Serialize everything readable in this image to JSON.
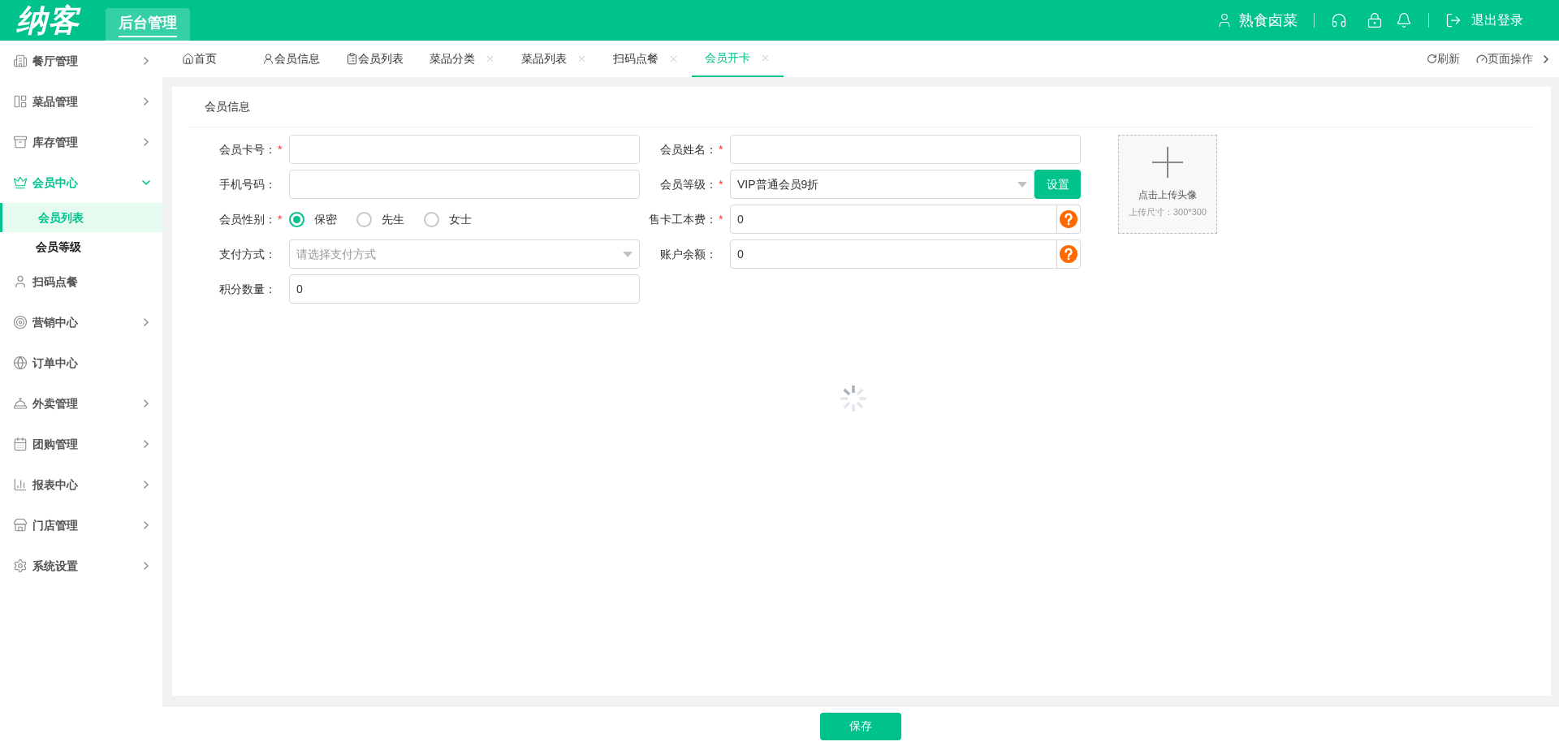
{
  "header": {
    "logo": "纳客",
    "module_tab": "后台管理",
    "user": "熟食卤菜",
    "logout": "退出登录"
  },
  "sidebar": {
    "items": [
      {
        "label": "餐厅管理",
        "kind": "group",
        "expanded": false
      },
      {
        "label": "菜品管理",
        "kind": "group",
        "expanded": false
      },
      {
        "label": "库存管理",
        "kind": "group",
        "expanded": false
      },
      {
        "label": "会员中心",
        "kind": "group",
        "expanded": true,
        "children": [
          {
            "label": "会员列表",
            "selected": true
          },
          {
            "label": "会员等级",
            "selected": false
          }
        ]
      },
      {
        "label": "扫码点餐",
        "kind": "link",
        "expanded": false
      },
      {
        "label": "营销中心",
        "kind": "group",
        "expanded": false
      },
      {
        "label": "订单中心",
        "kind": "link",
        "expanded": false
      },
      {
        "label": "外卖管理",
        "kind": "group",
        "expanded": false
      },
      {
        "label": "团购管理",
        "kind": "group",
        "expanded": false
      },
      {
        "label": "报表中心",
        "kind": "group",
        "expanded": false
      },
      {
        "label": "门店管理",
        "kind": "group",
        "expanded": false
      },
      {
        "label": "系统设置",
        "kind": "group",
        "expanded": false
      }
    ]
  },
  "tabs": [
    {
      "label": "首页",
      "selected": false,
      "closable": false
    },
    {
      "label": "会员信息",
      "selected": false,
      "closable": false
    },
    {
      "label": "会员列表",
      "selected": false,
      "closable": false
    },
    {
      "label": "菜品分类",
      "selected": false,
      "closable": true
    },
    {
      "label": "菜品列表",
      "selected": false,
      "closable": true
    },
    {
      "label": "扫码点餐",
      "selected": false,
      "closable": true
    },
    {
      "label": "会员开卡",
      "selected": true,
      "closable": true
    }
  ],
  "tab_actions": {
    "refresh": "刷新",
    "page_ops": "页面操作"
  },
  "form": {
    "title": "会员信息",
    "required_mark": "*",
    "left": [
      {
        "kind": "text",
        "label": "会员卡号：",
        "required": true
      },
      {
        "kind": "text",
        "label": "手机号码：",
        "required": false
      },
      {
        "kind": "radio",
        "label": "会员性别：",
        "required": true,
        "options": [
          {
            "label": "保密",
            "selected": true
          },
          {
            "label": "先生",
            "selected": false
          },
          {
            "label": "女士",
            "selected": false
          }
        ]
      },
      {
        "kind": "select",
        "label": "支付方式：",
        "required": false,
        "placeholder": "请选择支付方式"
      },
      {
        "kind": "text",
        "label": "积分数量：",
        "required": false,
        "value": "0"
      }
    ],
    "right": [
      {
        "kind": "text",
        "label": "会员姓名：",
        "required": true
      },
      {
        "kind": "select",
        "label": "会员等级：",
        "required": true,
        "value": "VIP普通会员9折",
        "button": "设置"
      },
      {
        "kind": "help",
        "label": "售卡工本费：",
        "required": true,
        "value": "0"
      },
      {
        "kind": "help",
        "label": "账户余额：",
        "required": false,
        "value": "0"
      }
    ],
    "upload": {
      "title": "点击上传头像",
      "hint": "上传尺寸：300*300"
    }
  },
  "save_button": "保存"
}
